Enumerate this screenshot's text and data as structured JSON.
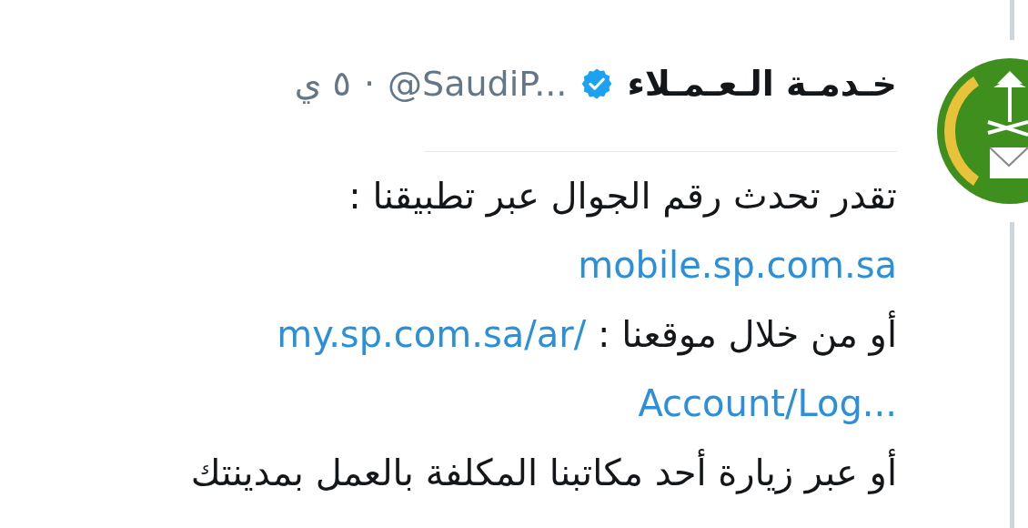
{
  "tweet": {
    "author": {
      "name": "خـدمـة الـعـمـلاء",
      "verified": true,
      "handle": "@SaudiP...",
      "separator": "·",
      "time": "٥ ي"
    },
    "body": [
      {
        "segments": [
          {
            "kind": "text",
            "text": "تقدر تحدث رقم الجوال عبر تطبيقنا :"
          }
        ]
      },
      {
        "segments": [
          {
            "kind": "link",
            "text": "mobile.sp.com.sa"
          }
        ]
      },
      {
        "segments": [
          {
            "kind": "text",
            "text": "أو من خلال موقعنا :"
          },
          {
            "kind": "link",
            "text": "my.sp.com.sa/ar/"
          }
        ]
      },
      {
        "segments": [
          {
            "kind": "link",
            "text": "Account/Log..."
          }
        ]
      },
      {
        "segments": [
          {
            "kind": "text",
            "text": "أو عبر زيارة أحد مكاتبنا المكلفة بالعمل بمدينتك"
          }
        ]
      }
    ]
  }
}
